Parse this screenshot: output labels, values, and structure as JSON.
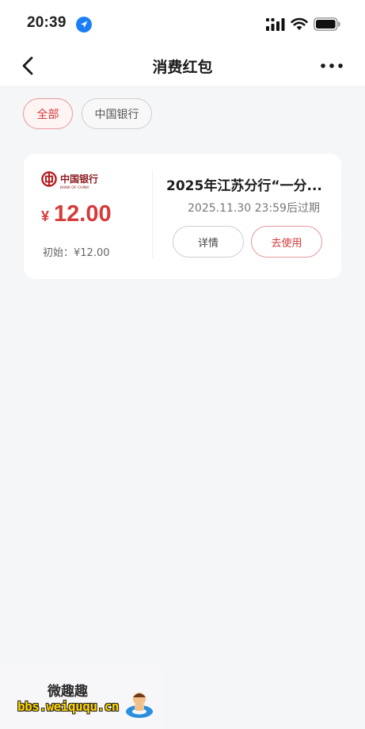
{
  "status_bar": {
    "time": "20:39",
    "icons": [
      "location-icon",
      "signal-icon",
      "wifi-icon",
      "battery-icon"
    ]
  },
  "nav": {
    "title": "消费红包",
    "icons": [
      "back-icon",
      "more-icon"
    ]
  },
  "filters": {
    "items": [
      {
        "label": "全部",
        "selected": true
      },
      {
        "label": "中国银行",
        "selected": false
      }
    ]
  },
  "voucher": {
    "bank_logo_text": "中国银行",
    "bank_logo_subtext": "BANK OF CHINA",
    "currency": "¥",
    "amount": "12.00",
    "initial": "初始：¥12.00",
    "title": "2025年江苏分行“一分...",
    "expiry": "2025.11.30 23:59后过期",
    "detail_label": "详情",
    "use_label": "去使用"
  },
  "watermark": {
    "title": "微趣趣",
    "url": "bbs.weiququ.cn"
  },
  "colors": {
    "accent_red": "#d63a3a",
    "background": "#f5f6f8",
    "card": "#ffffff",
    "location_blue": "#1a7ff5"
  }
}
